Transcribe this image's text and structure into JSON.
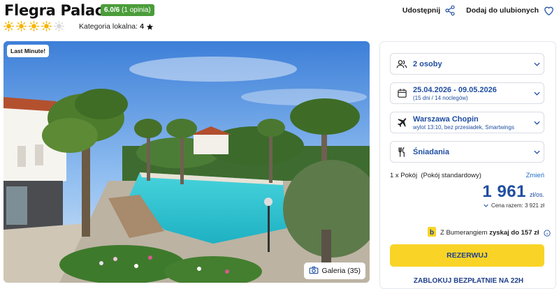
{
  "header": {
    "hotel_name": "Flegra Palace",
    "rating_score": "6.0/6",
    "rating_reviews": "(1 opinia)",
    "sun_rating": 4,
    "sun_total": 5,
    "local_category_label": "Kategoria lokalna:",
    "local_category_value": "4",
    "share_label": "Udostępnij",
    "favorite_label": "Dodaj do ulubionych"
  },
  "gallery": {
    "badge": "Last Minute!",
    "button_label": "Galeria (35)"
  },
  "booking": {
    "guests": {
      "label": "2 osoby",
      "icon": "person-icon"
    },
    "dates": {
      "label": "25.04.2026 - 09.05.2026",
      "sub": "(15 dni / 14 noclegów)",
      "icon": "calendar-icon"
    },
    "flight": {
      "label": "Warszawa Chopin",
      "sub": "wylot 13:10, bez przesiadek, Smartwings",
      "icon": "plane-icon"
    },
    "board": {
      "label": "Śniadania",
      "icon": "cutlery-icon"
    },
    "room_text": "1 x Pokój  (Pokój standardowy)",
    "change_label": "Zmień",
    "price_value": "1 961",
    "price_unit": "zł/os.",
    "total_text": "Cena razem: 3 921 zł",
    "boomerang_prefix": "Z Bumerangiem",
    "boomerang_bold": "zyskaj do 157 zł",
    "reserve_label": "REZERWUJ",
    "block_label": "ZABLOKUJ BEZPŁATNIE NA 22H"
  },
  "colors": {
    "accent_blue": "#1f4ea1",
    "rating_green": "#4a9d3a",
    "reserve_yellow": "#f9d426",
    "sun_yellow": "#f5b400"
  }
}
